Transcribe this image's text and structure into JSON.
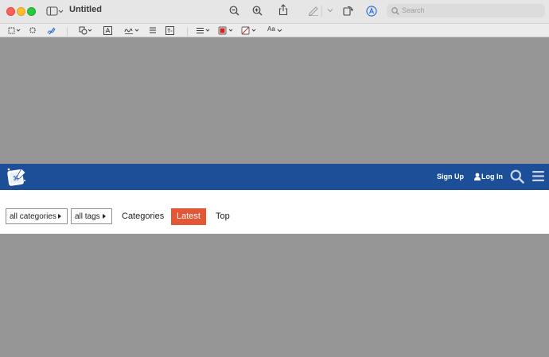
{
  "window": {
    "title": "Untitled",
    "search_placeholder": "Search"
  },
  "site": {
    "signup": "Sign Up",
    "login": "Log In",
    "colors": {
      "header": "#1d4f99",
      "active_tab": "#e45735"
    }
  },
  "filters": {
    "categories_dropdown": "all categories",
    "tags_dropdown": "all tags"
  },
  "nav": {
    "items": [
      "Categories",
      "Latest",
      "Top"
    ]
  },
  "toolbar_icons": [
    "selection-icon",
    "magic-select-icon",
    "sketch-icon",
    "shapes-icon",
    "text-icon",
    "sign-icon",
    "notes-icon",
    "text-box-icon",
    "line-style-icon",
    "border-color-icon",
    "fill-color-icon",
    "font-icon"
  ],
  "font_button_label": "Aa"
}
